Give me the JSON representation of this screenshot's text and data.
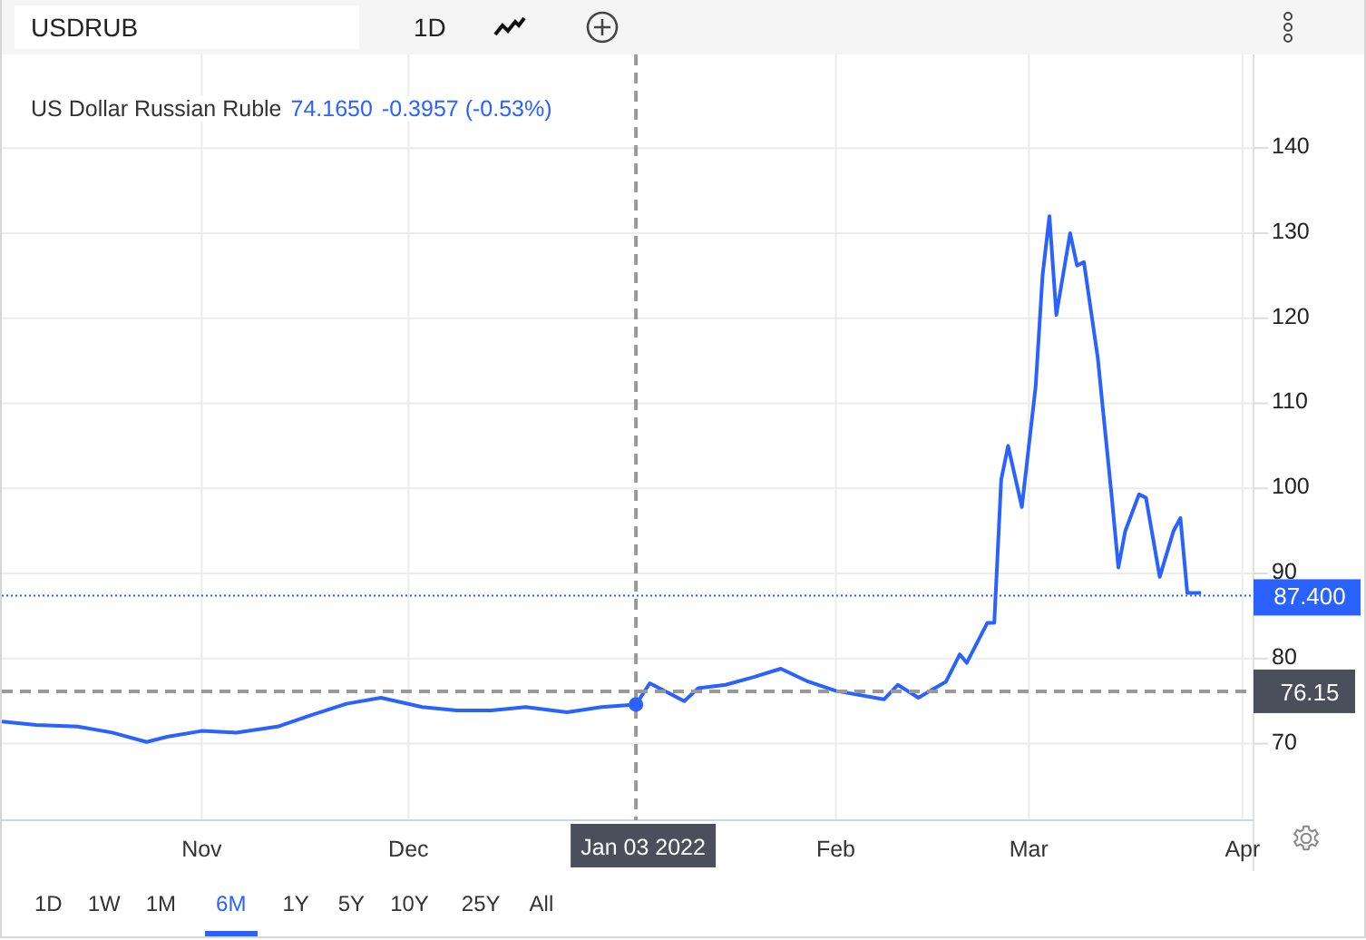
{
  "toolbar": {
    "symbol": "USDRUB",
    "interval": "1D"
  },
  "header": {
    "title": "US Dollar Russian Ruble",
    "price": "74.1650",
    "change": "-0.3957 (-0.53%)"
  },
  "chart_data": {
    "type": "line",
    "grid": true,
    "xlim": [
      "2021-10-03",
      "2022-04-02"
    ],
    "ylim": [
      61,
      151
    ],
    "xticks": [
      {
        "value": "2021-11-01",
        "label": "Nov"
      },
      {
        "value": "2021-12-01",
        "label": "Dec"
      },
      {
        "value": "2022-02-01",
        "label": "Feb"
      },
      {
        "value": "2022-03-01",
        "label": "Mar"
      },
      {
        "value": "2022-04-01",
        "label": "Apr"
      }
    ],
    "yticks": [
      70,
      80,
      90,
      100,
      110,
      120,
      130,
      140
    ],
    "x": [
      "2021-10-03",
      "2021-10-08",
      "2021-10-14",
      "2021-10-19",
      "2021-10-24",
      "2021-10-27",
      "2021-11-01",
      "2021-11-06",
      "2021-11-12",
      "2021-11-17",
      "2021-11-22",
      "2021-11-27",
      "2021-12-03",
      "2021-12-08",
      "2021-12-13",
      "2021-12-18",
      "2021-12-24",
      "2021-12-29",
      "2022-01-03",
      "2022-01-05",
      "2022-01-10",
      "2022-01-12",
      "2022-01-16",
      "2022-01-20",
      "2022-01-24",
      "2022-01-28",
      "2022-02-01",
      "2022-02-08",
      "2022-02-10",
      "2022-02-13",
      "2022-02-17",
      "2022-02-19",
      "2022-02-20",
      "2022-02-23",
      "2022-02-24",
      "2022-02-25",
      "2022-02-26",
      "2022-02-28",
      "2022-03-02",
      "2022-03-03",
      "2022-03-04",
      "2022-03-05",
      "2022-03-07",
      "2022-03-08",
      "2022-03-09",
      "2022-03-11",
      "2022-03-13",
      "2022-03-14",
      "2022-03-15",
      "2022-03-17",
      "2022-03-18",
      "2022-03-20",
      "2022-03-22",
      "2022-03-23",
      "2022-03-24",
      "2022-03-26"
    ],
    "series": [
      {
        "color": "#2962ff",
        "values": [
          72.6,
          72.2,
          72,
          71.3,
          70.2,
          70.8,
          71.5,
          71.3,
          72,
          73.4,
          74.7,
          75.4,
          74.3,
          73.9,
          73.9,
          74.3,
          73.7,
          74.3,
          74.6,
          77.1,
          75,
          76.5,
          76.9,
          77.8,
          78.8,
          77.3,
          76.2,
          75.2,
          76.9,
          75.4,
          77.3,
          80.5,
          79.5,
          84.2,
          84.2,
          101,
          105,
          97.8,
          112,
          125,
          132,
          120.4,
          130,
          126.2,
          126.6,
          115.4,
          99.3,
          90.7,
          95,
          99.3,
          98.9,
          89.6,
          95,
          96.5,
          87.7,
          87.7
        ]
      }
    ],
    "ref_lines": [
      {
        "axis": "y",
        "value": 87.4,
        "label": "87.400",
        "color": "#2962ff"
      },
      {
        "axis": "y",
        "value": 76.15,
        "label": "76.15",
        "color": "#999999"
      },
      {
        "axis": "x",
        "value": "2022-01-03",
        "label": "Jan 03 2022",
        "color": "#999999"
      }
    ]
  },
  "ranges": [
    {
      "label": "1D",
      "selected": false
    },
    {
      "label": "1W",
      "selected": false
    },
    {
      "label": "1M",
      "selected": false
    },
    {
      "label": "6M",
      "selected": true
    },
    {
      "label": "1Y",
      "selected": false
    },
    {
      "label": "5Y",
      "selected": false
    },
    {
      "label": "10Y",
      "selected": false
    },
    {
      "label": "25Y",
      "selected": false
    },
    {
      "label": "All",
      "selected": false
    }
  ]
}
